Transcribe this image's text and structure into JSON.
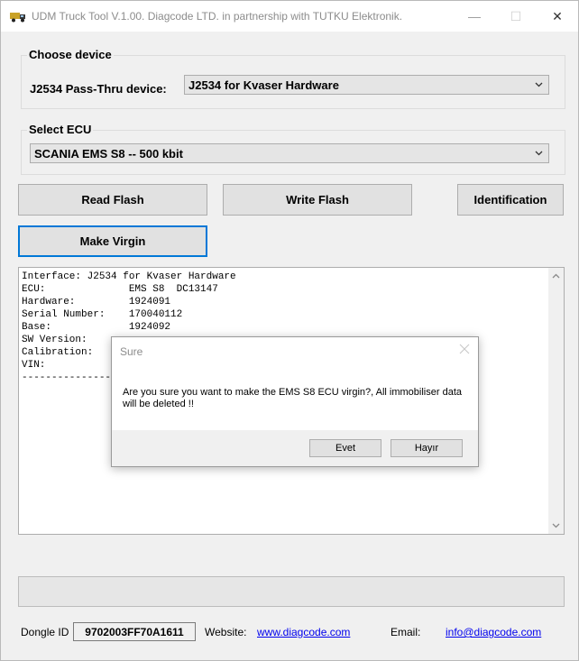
{
  "window": {
    "title": "UDM Truck Tool V.1.00. Diagcode LTD. in partnership with TUTKU Elektronik.",
    "controls": {
      "minimize": "—",
      "maximize": "☐",
      "close": "✕"
    }
  },
  "choose_device": {
    "group_label": "Choose device",
    "field_label": "J2534 Pass-Thru device:",
    "selected": "J2534 for Kvaser Hardware"
  },
  "select_ecu": {
    "group_label": "Select ECU",
    "selected": "SCANIA EMS S8 -- 500 kbit"
  },
  "buttons": {
    "read_flash": "Read Flash",
    "write_flash": "Write Flash",
    "identification": "Identification",
    "make_virgin": "Make Virgin"
  },
  "log": {
    "text": "Interface: J2534 for Kvaser Hardware\nECU:              EMS S8  DC13147\nHardware:         1924091\nSerial Number:    170040112\nBase:             1924092\nSW Version:\nCalibration:\nVIN:\n--------------------------------"
  },
  "progress": {
    "value": 0
  },
  "footer": {
    "dongle_label": "Dongle ID",
    "dongle_id": "9702003FF70A1611",
    "website_label": "Website:",
    "website": "www.diagcode.com",
    "email_label": "Email:",
    "email": "info@diagcode.com"
  },
  "dialog": {
    "title": "Sure",
    "message": "Are you sure you want to make the EMS S8 ECU virgin?, All immobiliser data will be deleted !!",
    "yes_label": "Evet",
    "no_label": "Hayır"
  },
  "colors": {
    "accent": "#0078d7",
    "link": "#0000ee",
    "window_bg": "#f0f0f0"
  }
}
